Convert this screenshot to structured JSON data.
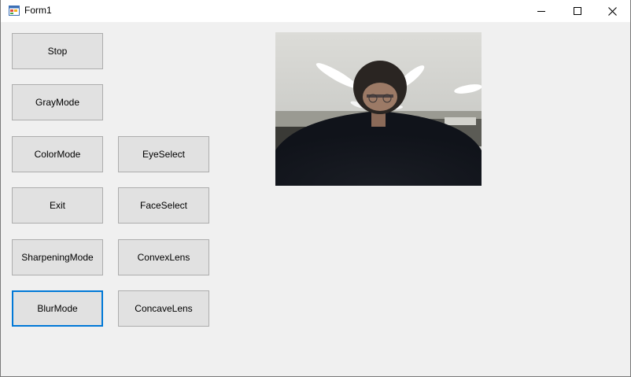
{
  "window": {
    "title": "Form1"
  },
  "buttons": {
    "stop": "Stop",
    "gray_mode": "GrayMode",
    "color_mode": "ColorMode",
    "exit": "Exit",
    "sharpening_mode": "SharpeningMode",
    "blur_mode": "BlurMode",
    "eye_select": "EyeSelect",
    "face_select": "FaceSelect",
    "convex_lens": "ConvexLens",
    "concave_lens": "ConcaveLens"
  },
  "focused_button": "blur_mode",
  "icons": {
    "app": "form-app-icon",
    "minimize": "minimize-icon",
    "maximize": "maximize-icon",
    "close": "close-icon"
  },
  "colors": {
    "window_bg": "#f0f0f0",
    "button_bg": "#e1e1e1",
    "button_border": "#adadad",
    "focus_border": "#0078d7",
    "titlebar_bg": "#ffffff"
  }
}
